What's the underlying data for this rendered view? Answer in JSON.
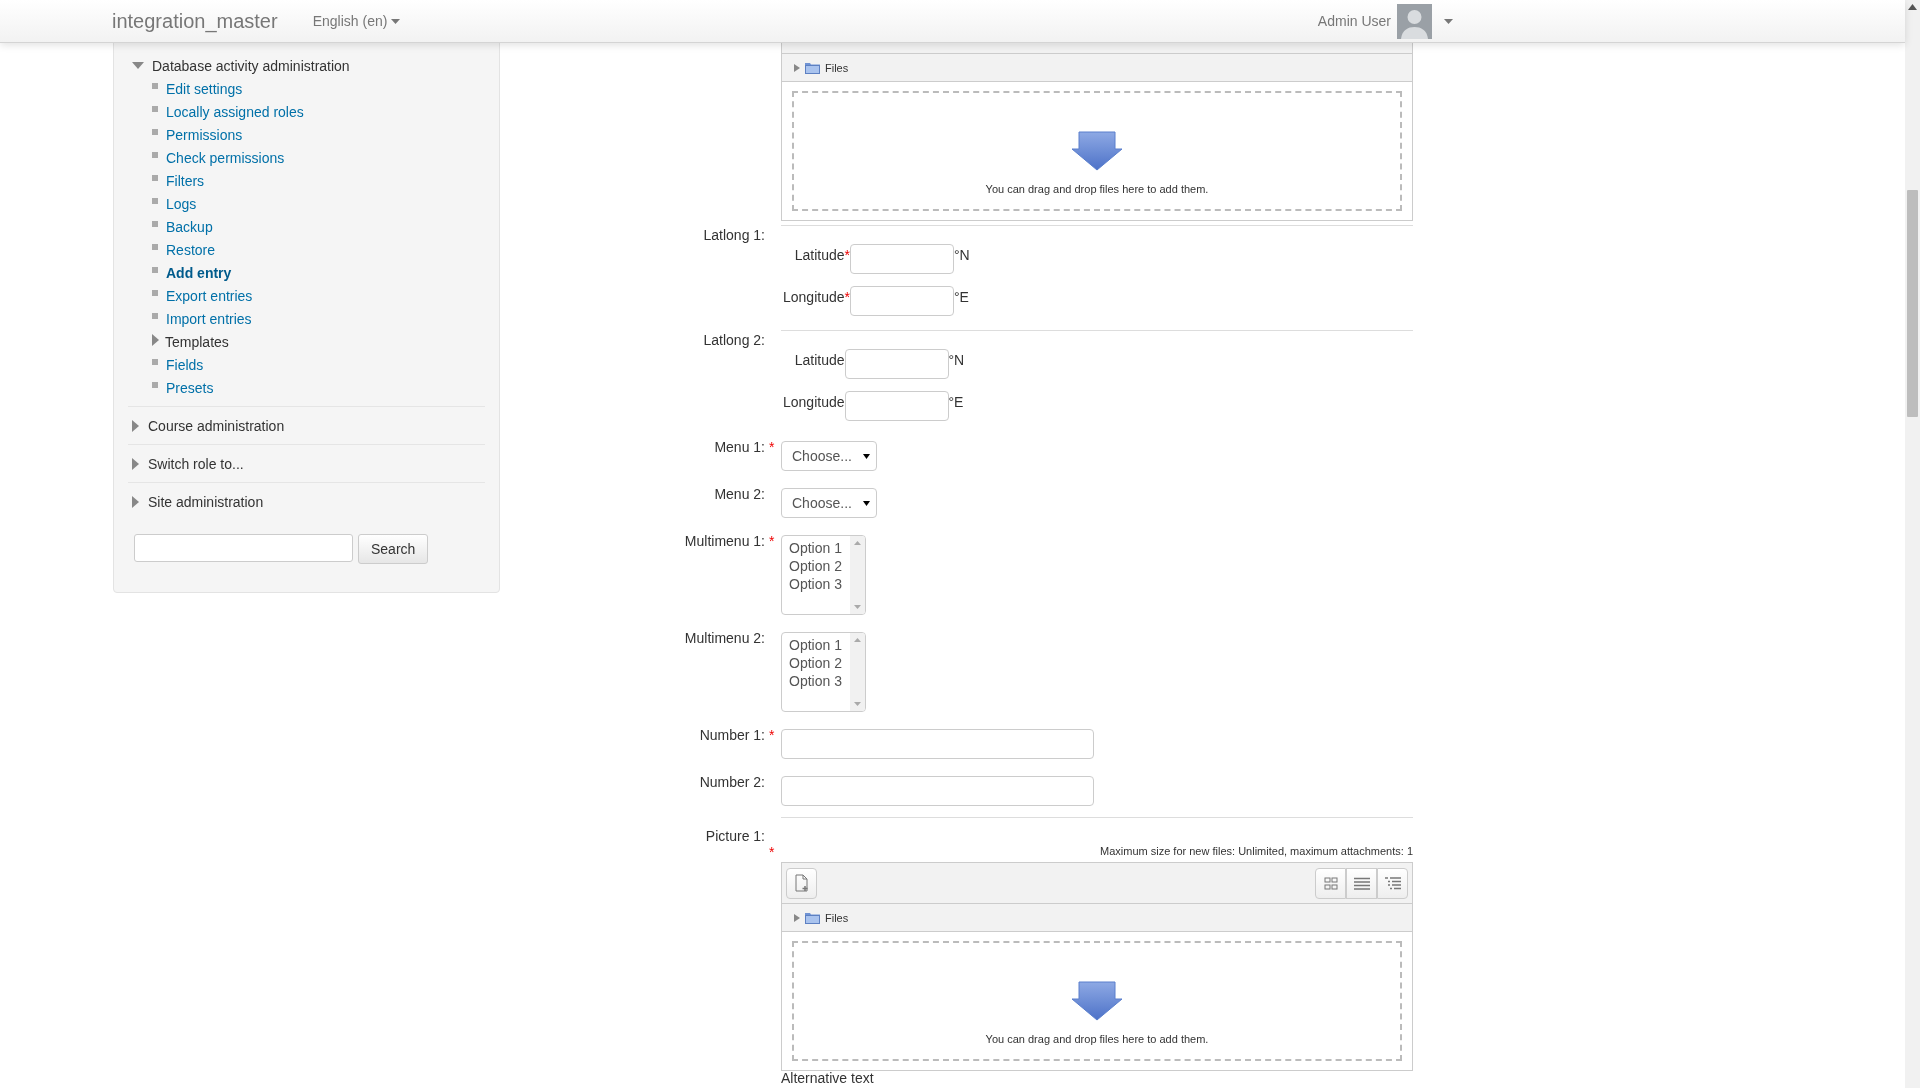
{
  "navbar": {
    "site_name": "integration_master",
    "language": "English (en)",
    "user_name": "Admin User"
  },
  "sidebar": {
    "sections": [
      {
        "title": "Database activity administration",
        "expanded": true,
        "items": [
          {
            "label": "Edit settings",
            "kind": "link",
            "selected": false
          },
          {
            "label": "Locally assigned roles",
            "kind": "link",
            "selected": false
          },
          {
            "label": "Permissions",
            "kind": "link",
            "selected": false
          },
          {
            "label": "Check permissions",
            "kind": "link",
            "selected": false
          },
          {
            "label": "Filters",
            "kind": "link",
            "selected": false
          },
          {
            "label": "Logs",
            "kind": "link",
            "selected": false
          },
          {
            "label": "Backup",
            "kind": "link",
            "selected": false
          },
          {
            "label": "Restore",
            "kind": "link",
            "selected": false
          },
          {
            "label": "Add entry",
            "kind": "link",
            "selected": true
          },
          {
            "label": "Export entries",
            "kind": "link",
            "selected": false
          },
          {
            "label": "Import entries",
            "kind": "link",
            "selected": false
          },
          {
            "label": "Templates",
            "kind": "folder",
            "selected": false
          },
          {
            "label": "Fields",
            "kind": "link",
            "selected": false
          },
          {
            "label": "Presets",
            "kind": "link",
            "selected": false
          }
        ]
      },
      {
        "title": "Course administration",
        "expanded": false
      },
      {
        "title": "Switch role to...",
        "expanded": false
      },
      {
        "title": "Site administration",
        "expanded": false
      }
    ],
    "search_button": "Search"
  },
  "form": {
    "required_mark": "*",
    "fields": [
      {
        "kind": "filemanager",
        "folder": "Files",
        "drop_hint": "You can drag and drop files here to add them."
      },
      {
        "kind": "latlong",
        "label": "Latlong 1:",
        "required": true,
        "parts": [
          {
            "label": "Latitude",
            "unit": "°N"
          },
          {
            "label": "Longitude",
            "unit": "°E"
          }
        ]
      },
      {
        "kind": "latlong",
        "label": "Latlong 2:",
        "required": false,
        "parts": [
          {
            "label": "Latitude",
            "unit": "°N"
          },
          {
            "label": "Longitude",
            "unit": "°E"
          }
        ]
      },
      {
        "kind": "menu",
        "label": "Menu 1:",
        "required": true,
        "value": "Choose..."
      },
      {
        "kind": "menu",
        "label": "Menu 2:",
        "required": false,
        "value": "Choose..."
      },
      {
        "kind": "multimenu",
        "label": "Multimenu 1:",
        "required": true,
        "options": [
          "Option 1",
          "Option 2",
          "Option 3"
        ]
      },
      {
        "kind": "multimenu",
        "label": "Multimenu 2:",
        "required": false,
        "options": [
          "Option 1",
          "Option 2",
          "Option 3"
        ]
      },
      {
        "kind": "number",
        "label": "Number 1:",
        "required": true
      },
      {
        "kind": "number",
        "label": "Number 2:",
        "required": false
      },
      {
        "kind": "picture",
        "label": "Picture 1:",
        "required": true,
        "limits": "Maximum size for new files: Unlimited, maximum attachments: 1",
        "folder": "Files",
        "drop_hint": "You can drag and drop files here to add them.",
        "alt_label": "Alternative text"
      }
    ]
  }
}
